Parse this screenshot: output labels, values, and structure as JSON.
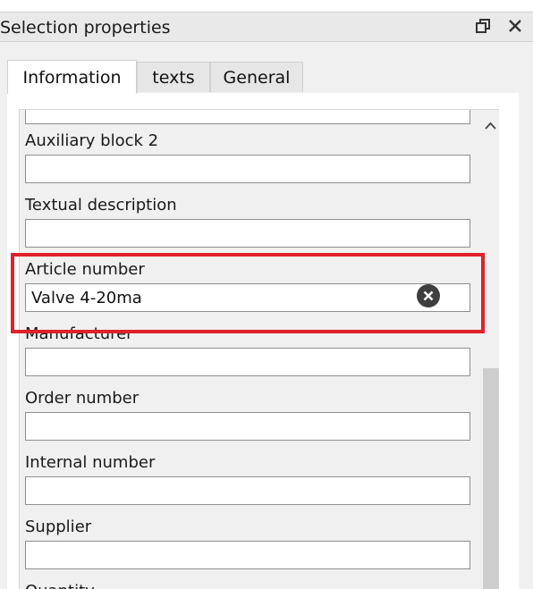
{
  "window": {
    "title": "Selection properties"
  },
  "tabs": [
    {
      "label": "Information",
      "active": true
    },
    {
      "label": "texts",
      "active": false
    },
    {
      "label": "General",
      "active": false
    }
  ],
  "fields": {
    "auxiliary_block_2": {
      "label": "Auxiliary block 2",
      "value": ""
    },
    "textual_description": {
      "label": "Textual description",
      "value": ""
    },
    "article_number": {
      "label": "Article number",
      "value": "Valve 4-20ma"
    },
    "manufacturer": {
      "label": "Manufacturer",
      "value": ""
    },
    "order_number": {
      "label": "Order number",
      "value": ""
    },
    "internal_number": {
      "label": "Internal number",
      "value": ""
    },
    "supplier": {
      "label": "Supplier",
      "value": ""
    },
    "quantity": {
      "label": "Quantity"
    }
  },
  "icons": {
    "restore": "restore-window-icon",
    "close": "close-icon",
    "clear": "clear-x-circle-icon",
    "scroll_up": "chevron-up-icon"
  },
  "colors": {
    "highlight": "#e0202a",
    "clear_button": "#3e3e3e"
  }
}
